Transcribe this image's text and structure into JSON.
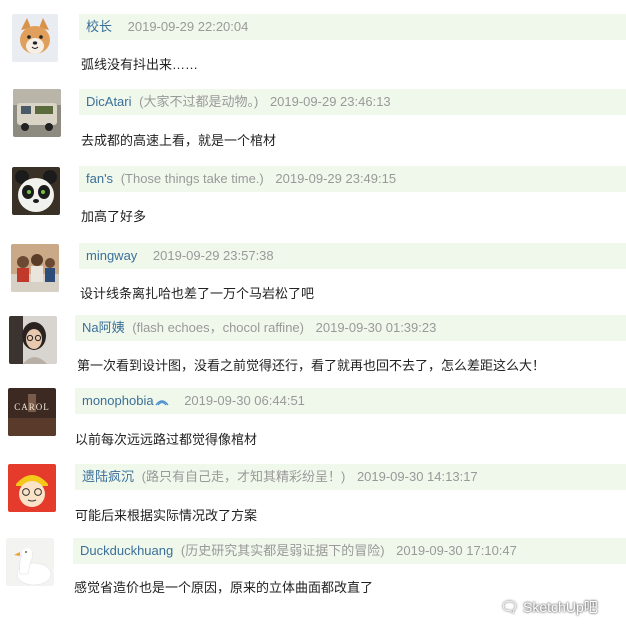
{
  "comments": [
    {
      "name": "校长",
      "nickname": "",
      "time": "2019-09-29 22:20:04",
      "text": "弧线没有抖出来……",
      "avatar": "shiba-dog-avatar"
    },
    {
      "name": "DicAtari",
      "nickname": "(大家不过都是动物。)",
      "time": "2019-09-29 23:46:13",
      "text": "去成都的高速上看，就是一个棺材",
      "avatar": "van-photo-avatar"
    },
    {
      "name": "fan's",
      "nickname": "(Those things take time.)",
      "time": "2019-09-29 23:49:15",
      "text": "加高了好多",
      "avatar": "kung-fu-panda-avatar"
    },
    {
      "name": "mingway",
      "nickname": "",
      "time": "2019-09-29 23:57:38",
      "text": "设计线条离扎哈也差了一万个马岩松了吧",
      "avatar": "group-photo-avatar"
    },
    {
      "name": "Na阿姨",
      "nickname": "(flash echoes，chocol raffine)",
      "time": "2019-09-30 01:39:23",
      "text": "第一次看到设计图，没看之前觉得还行，看了就再也回不去了，怎么差距这么大！",
      "avatar": "woman-glasses-avatar"
    },
    {
      "name": "monophobia",
      "nickname": "",
      "time": "2019-09-30 06:44:51",
      "text": "以前每次远远路过都觉得像棺材",
      "avatar": "carol-poster-avatar",
      "badge": "vip-badge-icon"
    },
    {
      "name": "遗陆疯沉",
      "nickname": "(路只有自己走，才知其精彩纷呈！)",
      "time": "2019-09-30 14:13:17",
      "text": "可能后来根据实际情况改了方案",
      "avatar": "cartoon-boy-avatar"
    },
    {
      "name": "Duckduckhuang",
      "nickname": "(历史研究其实都是弱证据下的冒险)",
      "time": "2019-09-30 17:10:47",
      "text": "感觉省造价也是一个原因，原来的立体曲面都改直了",
      "avatar": "white-duck-avatar"
    }
  ],
  "watermark": {
    "icon": "wechat-icon",
    "text": "SketchUp吧"
  }
}
